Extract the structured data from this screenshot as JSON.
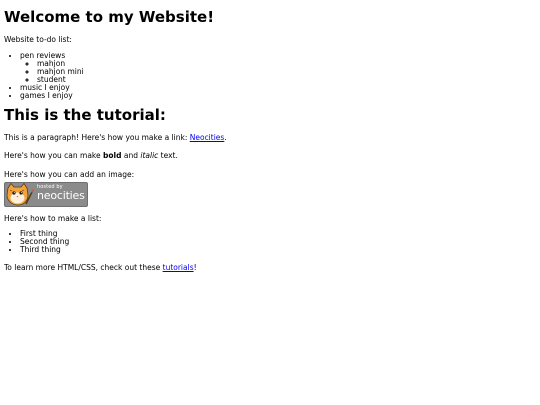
{
  "heading1": "Welcome to my Website!",
  "todo_label": "Website to-do list:",
  "todo": {
    "item1": "pen reviews",
    "sub": [
      "mahjon",
      "mahjon mini",
      "student"
    ],
    "item2": "music I enjoy",
    "item3": "games I enjoy"
  },
  "heading2": "This is the tutorial:",
  "para1": {
    "prefix": "This is a paragraph! Here's how you make a link: ",
    "link": "Neocities",
    "suffix": "."
  },
  "para2": {
    "prefix": "Here's how you can make ",
    "bold": "bold",
    "middle": " and ",
    "italic": "italic",
    "suffix": " text."
  },
  "para3": "Here's how you can add an image:",
  "badge": {
    "small": "hosted by",
    "big": "neocities"
  },
  "para4": "Here's how to make a list:",
  "list": [
    "First thing",
    "Second thing",
    "Third thing"
  ],
  "para5": {
    "prefix": "To learn more HTML/CSS, check out these ",
    "link": "tutorials",
    "suffix": "!"
  },
  "colors": {
    "link": "#0000ee",
    "badge_bg": "#8b8b8b",
    "cat_orange": "#f2a33a"
  }
}
